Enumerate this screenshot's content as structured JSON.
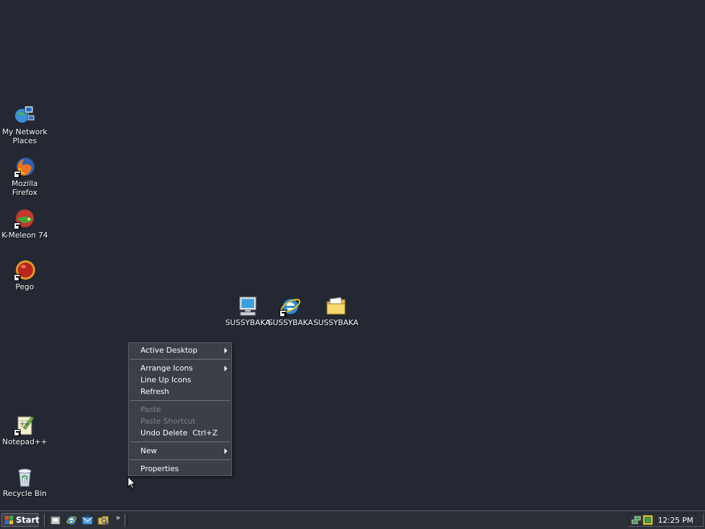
{
  "desktop": {
    "icons_left": [
      {
        "name": "my-network-places",
        "label": "My Network Places",
        "icon": "network-places-icon"
      },
      {
        "name": "mozilla-firefox",
        "label": "Mozilla Firefox",
        "icon": "firefox-icon"
      },
      {
        "name": "k-meleon",
        "label": "K-Meleon 74",
        "icon": "k-meleon-icon"
      },
      {
        "name": "pego",
        "label": "Pego",
        "icon": "pego-icon"
      },
      {
        "name": "notepad-plus-plus",
        "label": "Notepad++",
        "icon": "notepad-plus-plus-icon"
      },
      {
        "name": "recycle-bin",
        "label": "Recycle Bin",
        "icon": "recycle-bin-icon"
      }
    ],
    "icons_center": [
      {
        "name": "computer",
        "label": "SUSSYBAKA",
        "icon": "computer-icon"
      },
      {
        "name": "internet-explorer",
        "label": "SUSSYBAKA",
        "icon": "internet-explorer-icon"
      },
      {
        "name": "folder",
        "label": "SUSSYBAKA",
        "icon": "folder-icon"
      }
    ]
  },
  "context_menu": {
    "active_desktop": "Active Desktop",
    "arrange_icons": "Arrange Icons",
    "line_up_icons": "Line Up Icons",
    "refresh": "Refresh",
    "paste": "Paste",
    "paste_shortcut": "Paste Shortcut",
    "undo_delete": "Undo Delete",
    "undo_delete_shortcut": "Ctrl+Z",
    "new": "New",
    "properties": "Properties"
  },
  "taskbar": {
    "start_label": "Start",
    "quick_launch": [
      "show-desktop-icon",
      "internet-explorer-icon",
      "outlook-express-icon",
      "windows-explorer-icon"
    ],
    "chevron": "»",
    "clock": "12:25 PM",
    "tray_icons": [
      "network-tray-icon",
      "volume-tray-icon"
    ]
  },
  "colors": {
    "desktop_bg": "#232833",
    "menu_bg": "#3b4048",
    "taskbar_bg": "#2b3038"
  }
}
